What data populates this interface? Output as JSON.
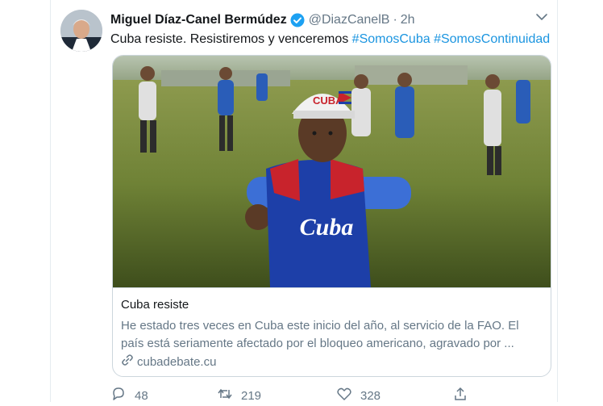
{
  "tweet": {
    "author_name": "Miguel Díaz-Canel Bermúdez",
    "handle": "@DiazCanelB",
    "separator": "·",
    "time": "2h",
    "text": "Cuba resiste. Resistiremos y venceremos",
    "hashtags": [
      "#SomosCuba",
      "#SomosContinuidad"
    ]
  },
  "card": {
    "title": "Cuba resiste",
    "description": "He estado tres veces en Cuba este inicio del año, al servicio de la FAO. El país está seriamente afectado por el bloqueo americano, agravado por ...",
    "domain": "cubadebate.cu",
    "cap_text": "CUBA",
    "jersey_text": "Cuba"
  },
  "actions": {
    "replies": "48",
    "retweets": "219",
    "likes": "328"
  },
  "colors": {
    "text": "#14171a",
    "secondary": "#657786",
    "link": "#1b95e0",
    "verified": "#1da1f2"
  },
  "icons": [
    "avatar",
    "verified-badge-icon",
    "chevron-down-icon",
    "link-icon",
    "reply-icon",
    "retweet-icon",
    "like-icon",
    "share-icon"
  ]
}
